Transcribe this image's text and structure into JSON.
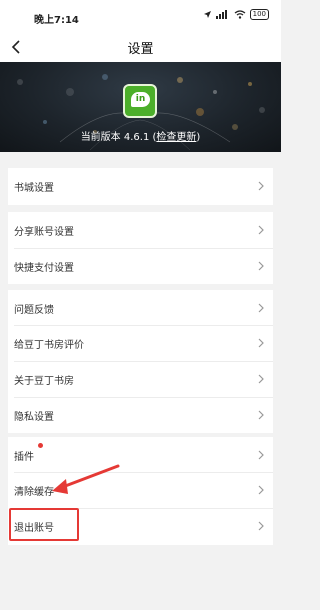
{
  "status_bar": {
    "time": "晚上7:14",
    "battery": "100"
  },
  "nav": {
    "title": "设置"
  },
  "banner": {
    "logo_text": "in",
    "version_prefix": "当前版本 4.6.1 (",
    "check_update": "检查更新",
    "version_suffix": ")"
  },
  "groups": [
    {
      "items": [
        {
          "label": "书城设置"
        }
      ]
    },
    {
      "items": [
        {
          "label": "分享账号设置"
        },
        {
          "label": "快捷支付设置"
        }
      ]
    },
    {
      "items": [
        {
          "label": "问题反馈"
        },
        {
          "label": "给豆丁书房评价"
        },
        {
          "label": "关于豆丁书房"
        },
        {
          "label": "隐私设置"
        }
      ]
    },
    {
      "items": [
        {
          "label": "插件"
        },
        {
          "label": "清除缓存"
        },
        {
          "label": "退出账号"
        }
      ]
    }
  ],
  "colors": {
    "accent_red": "#e53935",
    "logo_green": "#4caf2a"
  }
}
